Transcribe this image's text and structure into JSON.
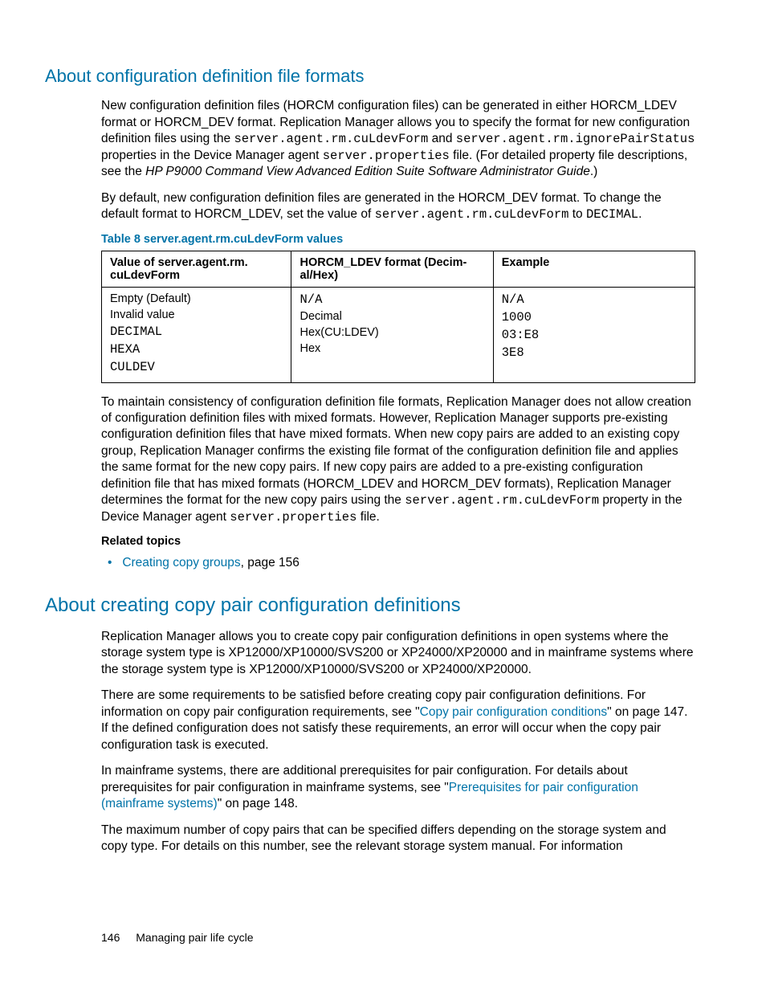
{
  "section1": {
    "heading": "About configuration definition file formats",
    "p1a": "New configuration definition files (HORCM configuration files) can be generated in either HORCM_LDEV format or HORCM_DEV format. Replication Manager allows you to specify the format for new configuration definition files using the ",
    "p1_prop1": "server.agent.rm.cuLdevForm",
    "p1b": " and ",
    "p1_prop2": "server.agent.rm.ignorePairStatus",
    "p1c": " properties in the Device Manager agent ",
    "p1_file": "server.properties",
    "p1d": " file. (For detailed property file descriptions, see the ",
    "p1_guide": "HP P9000 Command View Advanced Edition Suite Software Administrator Guide",
    "p1e": ".)",
    "p2a": "By default, new configuration definition files are generated in the HORCM_DEV format. To change the default format to HORCM_LDEV, set the value of ",
    "p2_prop": "server.agent.rm.cuLdevForm",
    "p2b": " to ",
    "p2_val": "DECIMAL",
    "p2c": ".",
    "table_caption": "Table 8 server.agent.rm.cuLdevForm values",
    "table": {
      "headers": {
        "h1a": "Value of server.agent.rm.",
        "h1b": "cuLdevForm",
        "h2a": "HORCM_LDEV format (Decim-",
        "h2b": "al/Hex)",
        "h3": "Example"
      },
      "col1": {
        "l1": "Empty (Default)",
        "l2": "Invalid value",
        "l3": "DECIMAL",
        "l4": "HEXA",
        "l5": "CULDEV"
      },
      "col2": {
        "l1": "N/A",
        "l2": "Decimal",
        "l3": "Hex(CU:LDEV)",
        "l4": "Hex"
      },
      "col3": {
        "l1": "N/A",
        "l2": "1000",
        "l3": "03:E8",
        "l4": "3E8"
      }
    },
    "p3a": "To maintain consistency of configuration definition file formats, Replication Manager does not allow creation of configuration definition files with mixed formats. However, Replication Manager supports pre-existing configuration definition files that have mixed formats. When new copy pairs are added to an existing copy group, Replication Manager confirms the existing file format of the configuration definition file and applies the same format for the new copy pairs. If new copy pairs are added to a pre-existing configuration definition file that has mixed formats (HORCM_LDEV and HORCM_DEV formats), Replication Manager determines the format for the new copy pairs using the ",
    "p3_prop": "server.agent.rm.cuLdevForm",
    "p3b": " property in the Device Manager agent ",
    "p3_file": "server.properties",
    "p3c": " file.",
    "related_heading": "Related topics",
    "related_link": "Creating copy groups",
    "related_suffix": ", page 156"
  },
  "section2": {
    "heading": "About creating copy pair configuration definitions",
    "p1": "Replication Manager allows you to create copy pair configuration definitions in open systems where the storage system type is XP12000/XP10000/SVS200 or XP24000/XP20000 and in mainframe systems where the storage system type is XP12000/XP10000/SVS200 or XP24000/XP20000.",
    "p2a": "There are some requirements to be satisfied before creating copy pair configuration definitions. For information on copy pair configuration requirements, see \"",
    "p2_link": "Copy pair configuration conditions",
    "p2b": "\" on page 147. If the defined configuration does not satisfy these requirements, an error will occur when the copy pair configuration task is executed.",
    "p3a": "In mainframe systems, there are additional prerequisites for pair configuration. For details about prerequisites for pair configuration in mainframe systems, see \"",
    "p3_link": "Prerequisites for pair configuration (mainframe systems)",
    "p3b": "\" on page 148.",
    "p4": "The maximum number of copy pairs that can be specified differs depending on the storage system and copy type. For details on this number, see the relevant storage system manual. For information"
  },
  "footer": {
    "page": "146",
    "title": "Managing pair life cycle"
  }
}
